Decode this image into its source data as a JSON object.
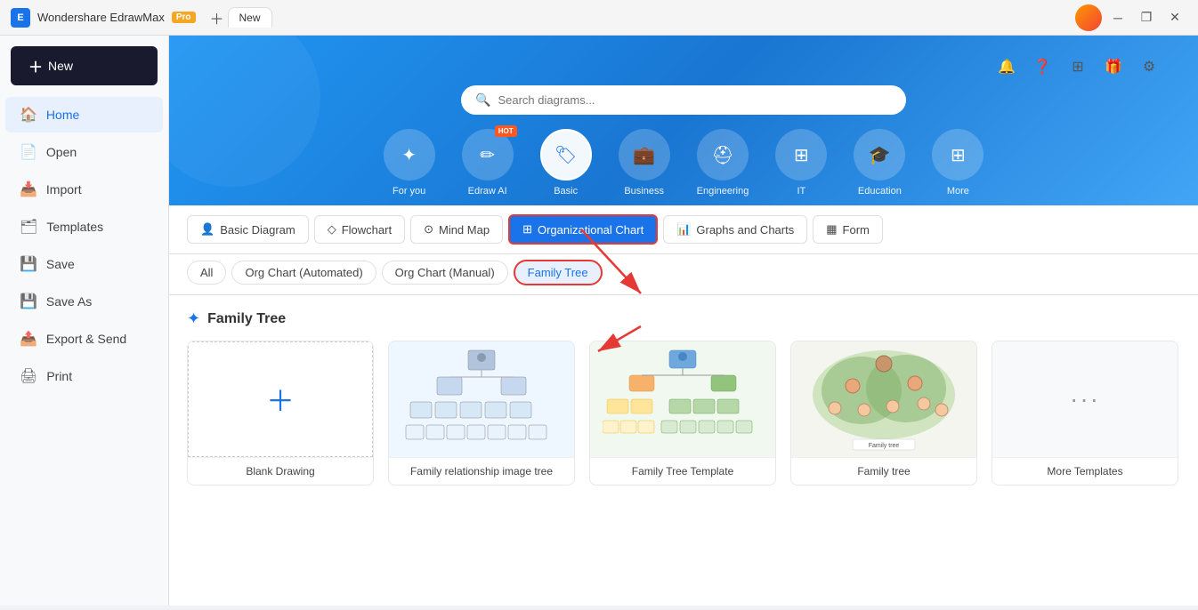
{
  "app": {
    "name": "Wondershare EdrawMax",
    "badge": "Pro"
  },
  "titlebar": {
    "tab_label": "New",
    "minimize": "–",
    "maximize": "❐",
    "close": "✕"
  },
  "sidebar": {
    "new_button": "+ New",
    "items": [
      {
        "id": "home",
        "label": "Home",
        "icon": "🏠",
        "active": true
      },
      {
        "id": "open",
        "label": "Open",
        "icon": "📄"
      },
      {
        "id": "import",
        "label": "Import",
        "icon": "📥"
      },
      {
        "id": "templates",
        "label": "Templates",
        "icon": "🗂"
      },
      {
        "id": "save",
        "label": "Save",
        "icon": "💾"
      },
      {
        "id": "save-as",
        "label": "Save As",
        "icon": "💾"
      },
      {
        "id": "export",
        "label": "Export & Send",
        "icon": "📤"
      },
      {
        "id": "print",
        "label": "Print",
        "icon": "🖨"
      }
    ]
  },
  "search": {
    "placeholder": "Search diagrams..."
  },
  "categories": [
    {
      "id": "for-you",
      "label": "For you",
      "icon": "✦",
      "active": false
    },
    {
      "id": "edraw-ai",
      "label": "Edraw AI",
      "icon": "✏",
      "hot": true,
      "active": false
    },
    {
      "id": "basic",
      "label": "Basic",
      "icon": "🏷",
      "active": true
    },
    {
      "id": "business",
      "label": "Business",
      "icon": "💼",
      "active": false
    },
    {
      "id": "engineering",
      "label": "Engineering",
      "icon": "⛑",
      "active": false
    },
    {
      "id": "it",
      "label": "IT",
      "icon": "⊞",
      "active": false
    },
    {
      "id": "education",
      "label": "Education",
      "icon": "🎓",
      "active": false
    },
    {
      "id": "more",
      "label": "More",
      "icon": "⊞",
      "active": false
    }
  ],
  "sub_tabs": [
    {
      "id": "basic-diagram",
      "label": "Basic Diagram",
      "icon": "👤",
      "active": false
    },
    {
      "id": "flowchart",
      "label": "Flowchart",
      "icon": "◇",
      "active": false
    },
    {
      "id": "mind-map",
      "label": "Mind Map",
      "icon": "⊙",
      "active": false
    },
    {
      "id": "org-chart",
      "label": "Organizational Chart",
      "icon": "⊞",
      "active": true
    },
    {
      "id": "graphs",
      "label": "Graphs and Charts",
      "icon": "📊",
      "active": false
    },
    {
      "id": "form",
      "label": "Form",
      "icon": "▦",
      "active": false
    }
  ],
  "filter_tabs": [
    {
      "id": "all",
      "label": "All",
      "active": false
    },
    {
      "id": "org-automated",
      "label": "Org Chart (Automated)",
      "active": false
    },
    {
      "id": "org-manual",
      "label": "Org Chart (Manual)",
      "active": false
    },
    {
      "id": "family-tree",
      "label": "Family Tree",
      "active": true
    }
  ],
  "templates_section": {
    "title": "Family Tree",
    "icon": "✦"
  },
  "templates": [
    {
      "id": "blank",
      "label": "Blank Drawing",
      "type": "blank"
    },
    {
      "id": "family-img-tree",
      "label": "Family relationship image tree",
      "type": "family-img"
    },
    {
      "id": "family-tree-template",
      "label": "Family Tree Template",
      "type": "family-template"
    },
    {
      "id": "family-tree",
      "label": "Family tree",
      "type": "family-tree"
    },
    {
      "id": "more",
      "label": "More Templates",
      "type": "more"
    }
  ],
  "top_right": {
    "notification_icon": "🔔",
    "help_icon": "❓",
    "grid_icon": "⊞",
    "gift_icon": "🎁",
    "settings_icon": "⚙"
  }
}
